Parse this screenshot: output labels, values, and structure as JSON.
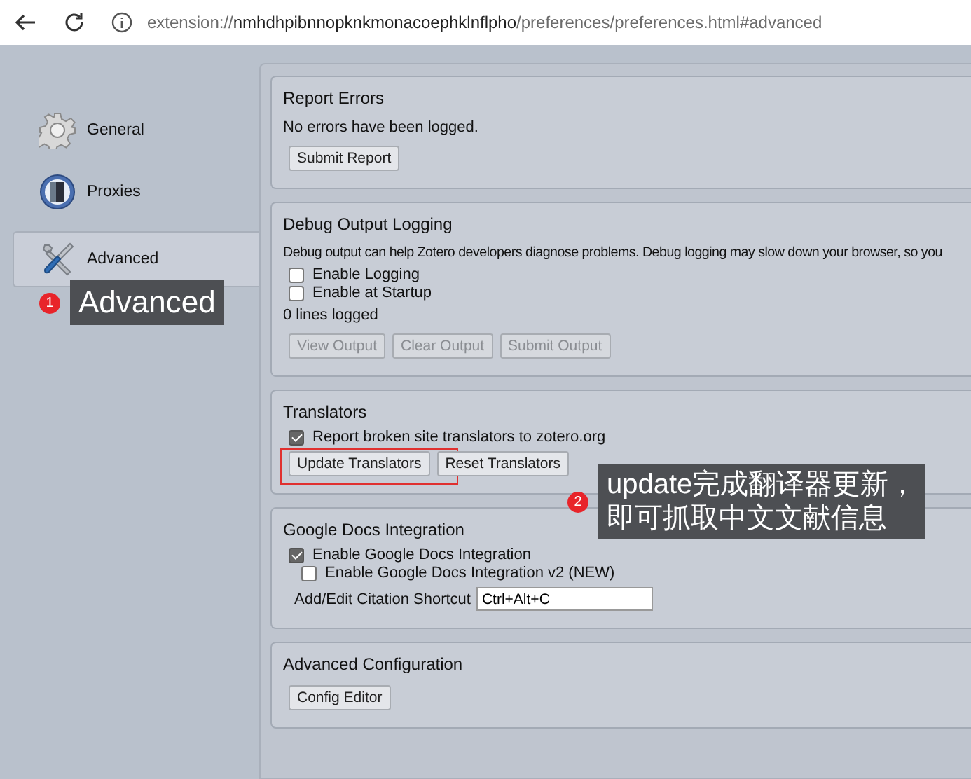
{
  "address_bar": {
    "url_scheme": "extension://",
    "url_host": "nmhdhpibnnopknkmonacoephklnflpho",
    "url_path": "/preferences/preferences.html#advanced"
  },
  "sidebar": {
    "items": [
      {
        "label": "General",
        "selected": false
      },
      {
        "label": "Proxies",
        "selected": false
      },
      {
        "label": "Advanced",
        "selected": true
      }
    ]
  },
  "sections": [
    {
      "title": "Report Errors",
      "items": [
        {
          "kind": "text",
          "text": "No errors have been logged."
        },
        {
          "kind": "buttons",
          "buttons": [
            {
              "label": "Submit Report",
              "disabled": false,
              "highlighted": false
            }
          ]
        }
      ]
    },
    {
      "title": "Debug Output Logging",
      "items": [
        {
          "kind": "text",
          "text": "Debug output can help Zotero developers diagnose problems. Debug logging may slow down your browser, so you"
        },
        {
          "kind": "checkbox",
          "label": "Enable Logging",
          "checked": false
        },
        {
          "kind": "checkbox",
          "label": "Enable at Startup",
          "checked": false
        },
        {
          "kind": "text",
          "text": "0 lines logged"
        },
        {
          "kind": "buttons",
          "buttons": [
            {
              "label": "View Output",
              "disabled": true,
              "highlighted": false
            },
            {
              "label": "Clear Output",
              "disabled": true,
              "highlighted": false
            },
            {
              "label": "Submit Output",
              "disabled": true,
              "highlighted": false
            }
          ]
        }
      ]
    },
    {
      "title": "Translators",
      "items": [
        {
          "kind": "checkbox",
          "label": "Report broken site translators to zotero.org",
          "checked": true
        },
        {
          "kind": "buttons",
          "buttons": [
            {
              "label": "Update Translators",
              "disabled": false,
              "highlighted": true
            },
            {
              "label": "Reset Translators",
              "disabled": false,
              "highlighted": false
            }
          ]
        }
      ]
    },
    {
      "title": "Google Docs Integration",
      "items": [
        {
          "kind": "checkbox",
          "label": "Enable Google Docs Integration",
          "checked": true,
          "children": [
            {
              "kind": "checkbox",
              "label": "Enable Google Docs Integration v2 (NEW)",
              "checked": false
            }
          ]
        },
        {
          "kind": "field",
          "label": "Add/Edit Citation Shortcut",
          "value": "Ctrl+Alt+C"
        }
      ]
    },
    {
      "title": "Advanced Configuration",
      "items": [
        {
          "kind": "buttons",
          "buttons": [
            {
              "label": "Config Editor",
              "disabled": false,
              "highlighted": false
            }
          ]
        }
      ]
    }
  ],
  "callouts": [
    {
      "number": "1",
      "lines": [
        "Advanced"
      ]
    },
    {
      "number": "2",
      "lines": [
        "update完成翻译器更新，",
        "即可抓取中文文献信息"
      ]
    }
  ]
}
